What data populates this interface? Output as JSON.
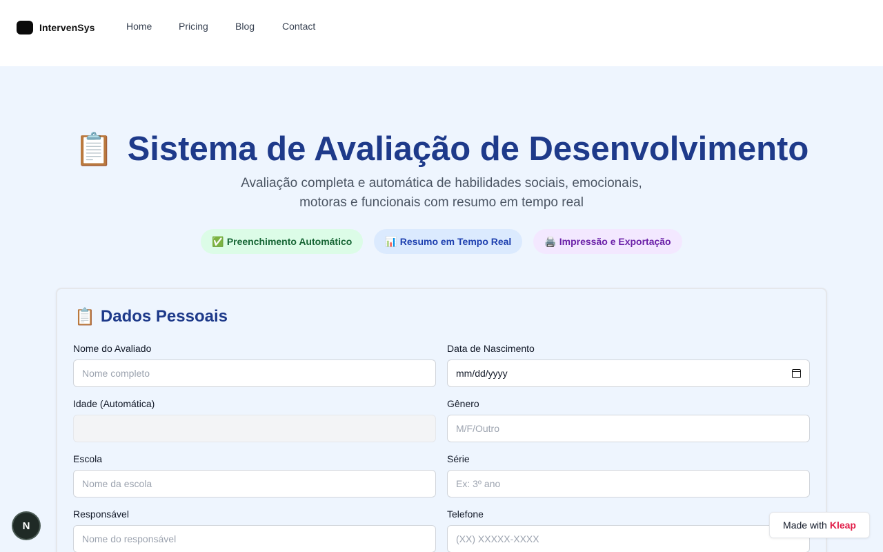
{
  "nav": {
    "brand": "IntervenSys",
    "links": [
      "Home",
      "Pricing",
      "Blog",
      "Contact"
    ]
  },
  "hero": {
    "icon": "📋",
    "title": "Sistema de Avaliação de Desenvolvimento",
    "subtitle_line1": "Avaliação completa e automática de habilidades sociais, emocionais,",
    "subtitle_line2": "motoras e funcionais com resumo em tempo real",
    "badges": [
      {
        "icon": "✅",
        "label": "Preenchimento Automático"
      },
      {
        "icon": "📊",
        "label": "Resumo em Tempo Real"
      },
      {
        "icon": "🖨️",
        "label": "Impressão e Exportação"
      }
    ]
  },
  "form": {
    "icon": "📋",
    "title": "Dados Pessoais",
    "fields": {
      "nome": {
        "label": "Nome do Avaliado",
        "placeholder": "Nome completo",
        "value": ""
      },
      "nascimento": {
        "label": "Data de Nascimento",
        "placeholder": "mm/dd/yyyy",
        "value": ""
      },
      "idade": {
        "label": "Idade (Automática)",
        "placeholder": "",
        "value": ""
      },
      "genero": {
        "label": "Gênero",
        "placeholder": "M/F/Outro",
        "value": ""
      },
      "escola": {
        "label": "Escola",
        "placeholder": "Nome da escola",
        "value": ""
      },
      "serie": {
        "label": "Série",
        "placeholder": "Ex: 3º ano",
        "value": ""
      },
      "responsavel": {
        "label": "Responsável",
        "placeholder": "Nome do responsável",
        "value": ""
      },
      "telefone": {
        "label": "Telefone",
        "placeholder": "(XX) XXXXX-XXXX",
        "value": ""
      }
    }
  },
  "widgets": {
    "n_badge": "N",
    "made_with": "Made with",
    "made_with_brand": "Kleap"
  },
  "colors": {
    "page_bg": "#eef5fe",
    "title": "#1e3a8a",
    "brand_accent": "#e11d48"
  }
}
